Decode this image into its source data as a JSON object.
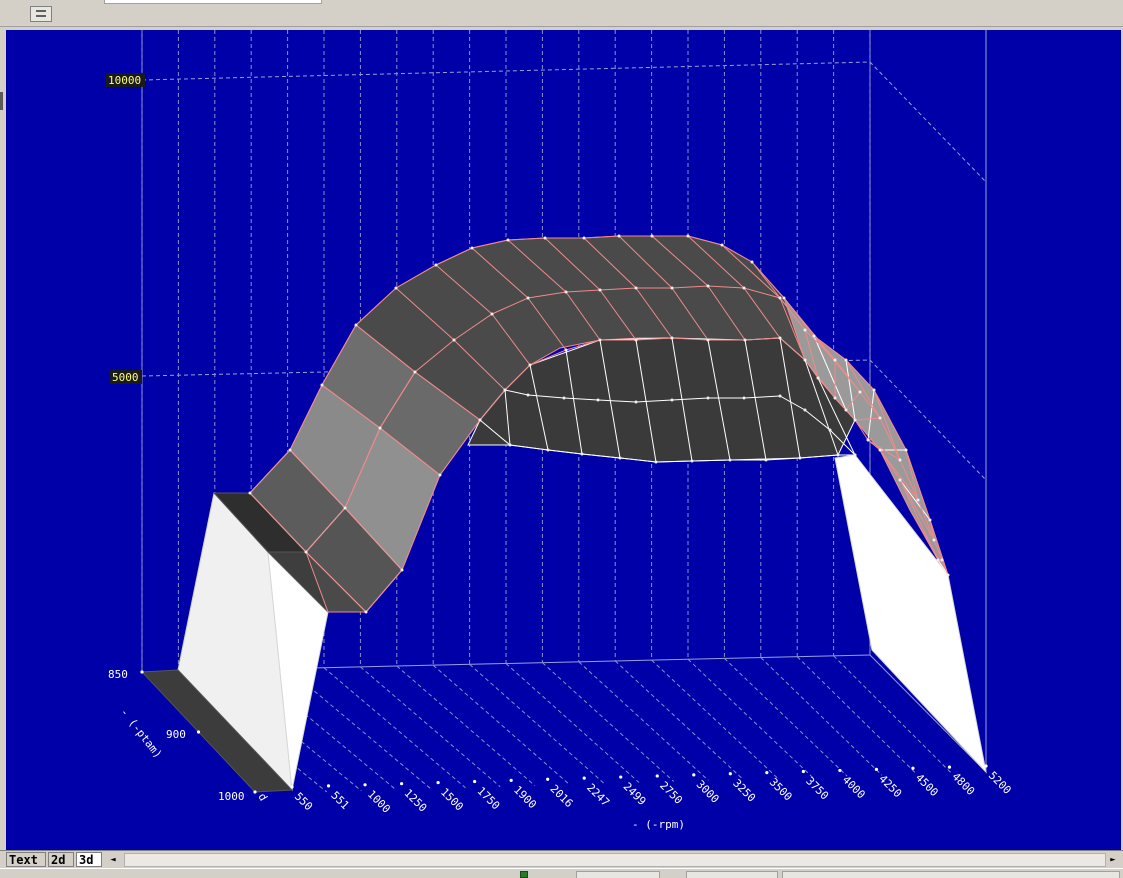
{
  "chart_data": {
    "type": "surface",
    "x_axis_label": "- (-rpm)",
    "y_axis_label": "- (-ptam)",
    "z_ticks": [
      "10000",
      "5000"
    ],
    "x_ticks": [
      "550",
      "551",
      "1000",
      "1250",
      "1500",
      "1750",
      "1900",
      "2016",
      "2247",
      "2499",
      "2750",
      "3000",
      "3250",
      "3500",
      "3750",
      "4000",
      "4250",
      "4500",
      "4800",
      "5200"
    ],
    "y_ticks": [
      "850",
      "900",
      "1000"
    ],
    "y_ticks_extra": [
      "d"
    ]
  },
  "tabs": {
    "text": "Text",
    "two_d": "2d",
    "three_d": "3d"
  },
  "scroll": {
    "left": "◄",
    "right": "►"
  },
  "colors": {
    "plot_bg": "#0000a8",
    "surface_dark": "#3c3c3c",
    "surface_light": "#f0f0f0",
    "grid_line": "#9aa0d8",
    "highlight_line": "#f08a8a"
  },
  "icons": {
    "toolbar_button": "panel-toggle-icon",
    "scroll_left": "scroll-left-arrow",
    "scroll_right": "scroll-right-arrow"
  }
}
